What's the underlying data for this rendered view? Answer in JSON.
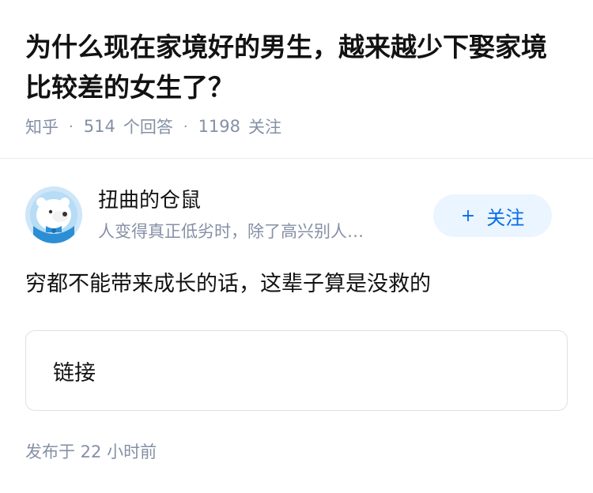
{
  "question": {
    "title": "为什么现在家境好的男生，越来越少下娶家境比较差的女生了？"
  },
  "meta": {
    "source": "知乎",
    "answer_count": "514",
    "answer_label": "个回答",
    "follower_count": "1198",
    "follower_label": "关注"
  },
  "author": {
    "name": "扭曲的仓鼠",
    "bio": "人变得真正低劣时，除了高兴别人…",
    "follow_label": "关注"
  },
  "answer": {
    "text": "穷都不能带来成长的话，这辈子算是没救的"
  },
  "link_card": {
    "label": "链接"
  },
  "footer": {
    "publish_time": "发布于 22 小时前"
  },
  "colors": {
    "accent": "#056de8",
    "follow_bg": "#ebf5ff",
    "meta_gray": "#8590a6"
  },
  "icons": {
    "avatar": "polar-bear-avatar-icon",
    "follow": "plus-icon"
  }
}
